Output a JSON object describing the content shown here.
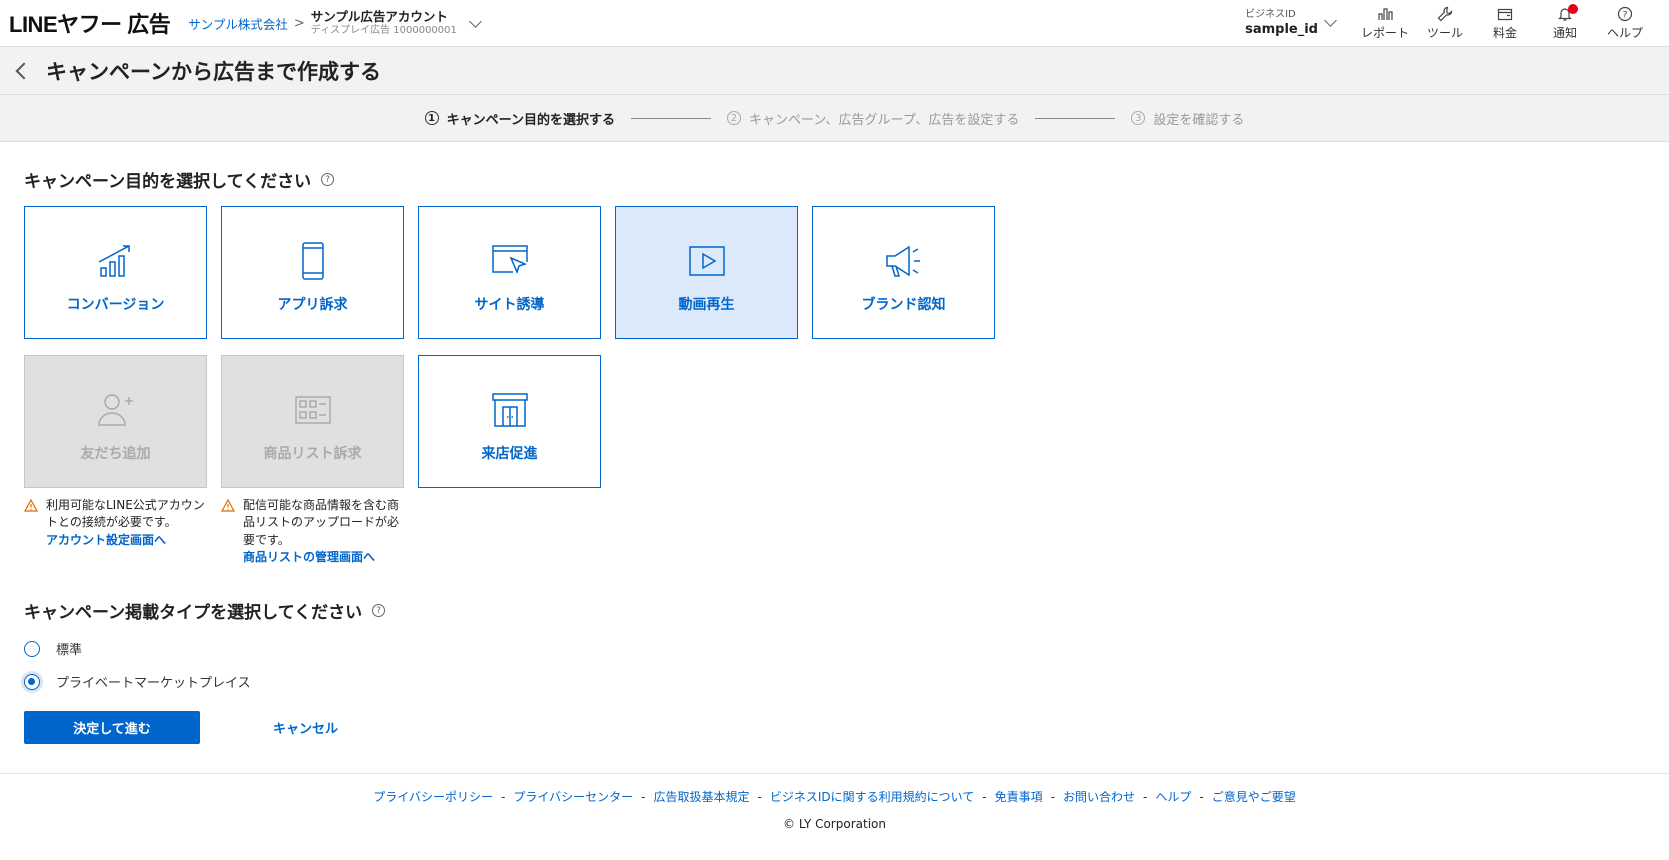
{
  "header": {
    "logo": "LINEヤフー 広告",
    "company": "サンプル株式会社",
    "account_name": "サンプル広告アカウント",
    "account_sub": "ディスプレイ広告 1000000001",
    "bizid_label": "ビジネスID",
    "bizid_value": "sample_id",
    "tools": [
      {
        "label": "レポート",
        "icon": "chart-icon"
      },
      {
        "label": "ツール",
        "icon": "wrench-icon"
      },
      {
        "label": "料金",
        "icon": "wallet-icon"
      },
      {
        "label": "通知",
        "icon": "bell-icon"
      },
      {
        "label": "ヘルプ",
        "icon": "help-icon"
      }
    ]
  },
  "page_title": "キャンペーンから広告まで作成する",
  "stepper": [
    {
      "num": "1",
      "label": "キャンペーン目的を選択する",
      "active": true
    },
    {
      "num": "2",
      "label": "キャンペーン、広告グループ、広告を設定する",
      "active": false
    },
    {
      "num": "3",
      "label": "設定を確認する",
      "active": false
    }
  ],
  "objective": {
    "title": "キャンペーン目的を選択してください",
    "cards": [
      {
        "label": "コンバージョン",
        "icon": "growth-chart-icon",
        "state": "normal"
      },
      {
        "label": "アプリ訴求",
        "icon": "smartphone-icon",
        "state": "normal"
      },
      {
        "label": "サイト誘導",
        "icon": "cursor-window-icon",
        "state": "normal"
      },
      {
        "label": "動画再生",
        "icon": "play-icon",
        "state": "selected"
      },
      {
        "label": "ブランド認知",
        "icon": "megaphone-icon",
        "state": "normal"
      },
      {
        "label": "友だち追加",
        "icon": "add-friend-icon",
        "state": "disabled"
      },
      {
        "label": "商品リスト訴求",
        "icon": "product-list-icon",
        "state": "disabled"
      },
      {
        "label": "来店促進",
        "icon": "store-icon",
        "state": "normal"
      }
    ],
    "notes": [
      {
        "text": "利用可能なLINE公式アカウントとの接続が必要です。",
        "link": "アカウント設定画面へ"
      },
      {
        "text": "配信可能な商品情報を含む商品リストのアップロードが必要です。",
        "link": "商品リストの管理画面へ"
      }
    ]
  },
  "placement": {
    "title": "キャンペーン掲載タイプを選択してください",
    "options": [
      {
        "label": "標準",
        "checked": false
      },
      {
        "label": "プライベートマーケットプレイス",
        "checked": true
      }
    ]
  },
  "actions": {
    "submit": "決定して進む",
    "cancel": "キャンセル"
  },
  "footer": {
    "links": [
      "プライバシーポリシー",
      "プライバシーセンター",
      "広告取扱基本規定",
      "ビジネスIDに関する利用規約について",
      "免責事項",
      "お問い合わせ",
      "ヘルプ",
      "ご意見やご要望"
    ],
    "separator": "-",
    "copyright": "© LY Corporation"
  },
  "colors": {
    "accent": "#0066cc",
    "selected_bg": "#dce9fb",
    "disabled_bg": "#e0e0e0",
    "warning": "#e06a00",
    "notify": "#e60012"
  }
}
